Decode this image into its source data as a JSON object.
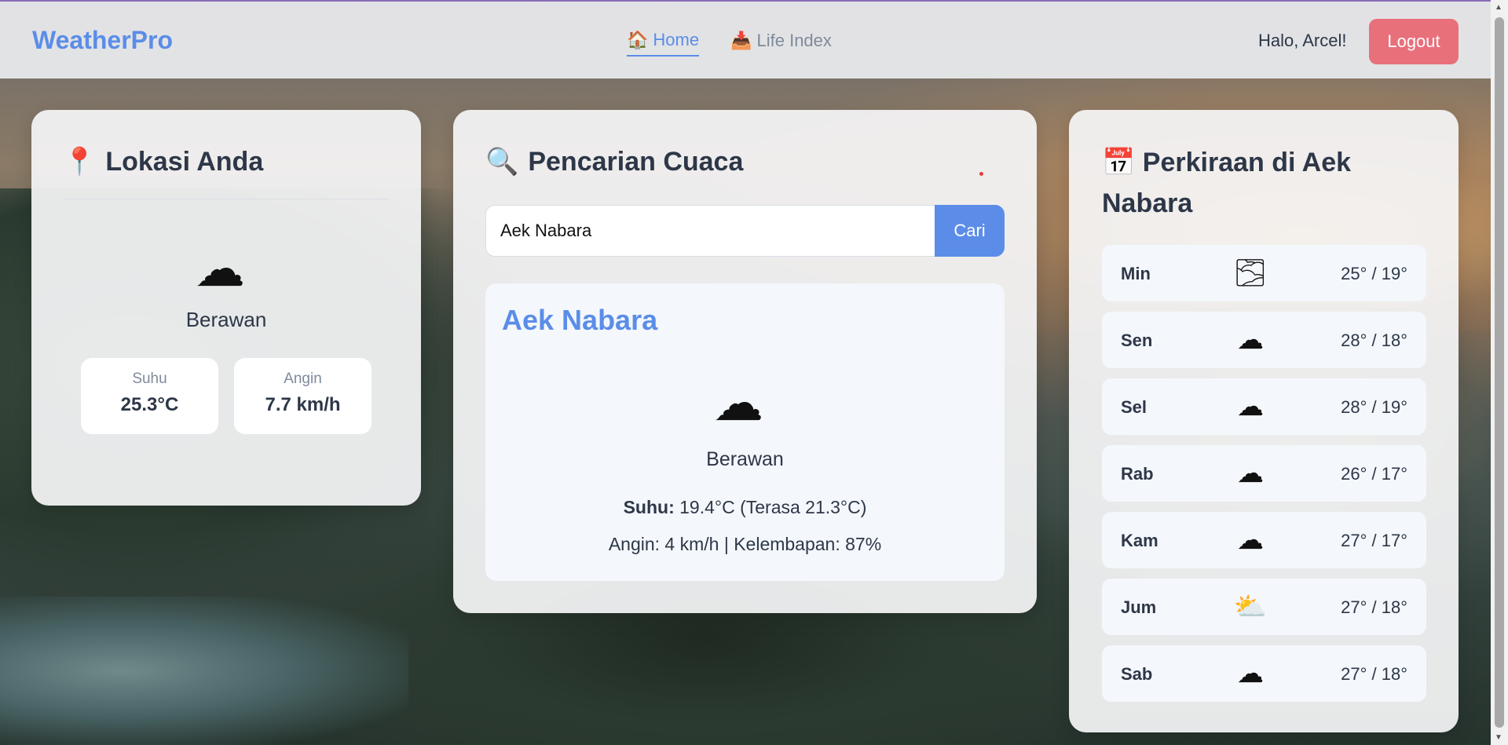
{
  "app": {
    "brand": "WeatherPro",
    "accent_color": "#5b8de8",
    "logout_color": "#e8707b"
  },
  "nav": {
    "items": [
      {
        "label": "Home",
        "icon": "house-icon",
        "glyph": "🏠",
        "active": true
      },
      {
        "label": "Life Index",
        "icon": "life-index-icon",
        "glyph": "📥",
        "active": false
      }
    ],
    "greeting": "Halo, Arcel!",
    "logout_label": "Logout"
  },
  "location_card": {
    "title": "Lokasi Anda",
    "title_icon": "📍",
    "condition_icon": "☁",
    "condition": "Berawan",
    "stats": [
      {
        "label": "Suhu",
        "value": "25.3°C"
      },
      {
        "label": "Angin",
        "value": "7.7 km/h"
      }
    ]
  },
  "search_card": {
    "title": "Pencarian Cuaca",
    "title_icon": "🔍",
    "search": {
      "value": "Aek Nabara",
      "placeholder": "",
      "button_label": "Cari"
    },
    "result": {
      "city": "Aek Nabara",
      "condition_icon": "☁",
      "condition": "Berawan",
      "temp_label": "Suhu:",
      "temp_value": "19.4°C (Terasa 21.3°C)",
      "details": "Angin: 4 km/h | Kelembapan: 87%"
    }
  },
  "forecast_card": {
    "title": "Perkiraan di Aek Nabara",
    "title_icon": "📅",
    "days": [
      {
        "day": "Min",
        "icon": "fog-icon",
        "glyph": "🌫",
        "temp": "25° / 19°"
      },
      {
        "day": "Sen",
        "icon": "cloud-icon",
        "glyph": "☁",
        "temp": "28° / 18°"
      },
      {
        "day": "Sel",
        "icon": "cloud-icon",
        "glyph": "☁",
        "temp": "28° / 19°"
      },
      {
        "day": "Rab",
        "icon": "cloud-icon",
        "glyph": "☁",
        "temp": "26° / 17°"
      },
      {
        "day": "Kam",
        "icon": "cloud-icon",
        "glyph": "☁",
        "temp": "27° / 17°"
      },
      {
        "day": "Jum",
        "icon": "partly-cloudy-icon",
        "glyph": "⛅",
        "temp": "27° / 18°"
      },
      {
        "day": "Sab",
        "icon": "cloud-icon",
        "glyph": "☁",
        "temp": "27° / 18°"
      }
    ]
  }
}
